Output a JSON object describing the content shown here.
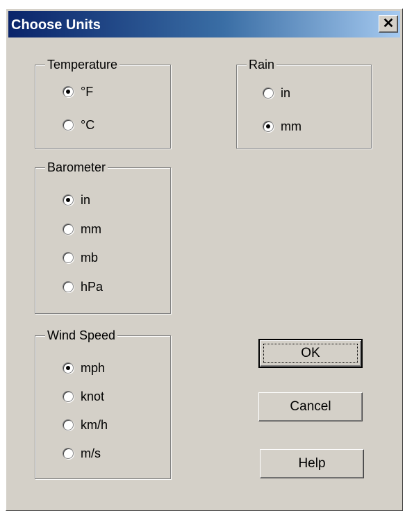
{
  "dialog": {
    "title": "Choose Units",
    "close_glyph": "✕"
  },
  "temperature": {
    "label": "Temperature",
    "options": [
      {
        "label": "°F",
        "checked": true
      },
      {
        "label": "°C",
        "checked": false
      }
    ]
  },
  "rain": {
    "label": "Rain",
    "options": [
      {
        "label": "in",
        "checked": false
      },
      {
        "label": "mm",
        "checked": true
      }
    ]
  },
  "barometer": {
    "label": "Barometer",
    "options": [
      {
        "label": "in",
        "checked": true
      },
      {
        "label": "mm",
        "checked": false
      },
      {
        "label": "mb",
        "checked": false
      },
      {
        "label": "hPa",
        "checked": false
      }
    ]
  },
  "wind": {
    "label": "Wind Speed",
    "options": [
      {
        "label": "mph",
        "checked": true
      },
      {
        "label": "knot",
        "checked": false
      },
      {
        "label": "km/h",
        "checked": false
      },
      {
        "label": "m/s",
        "checked": false
      }
    ]
  },
  "buttons": {
    "ok": "OK",
    "cancel": "Cancel",
    "help": "Help"
  }
}
